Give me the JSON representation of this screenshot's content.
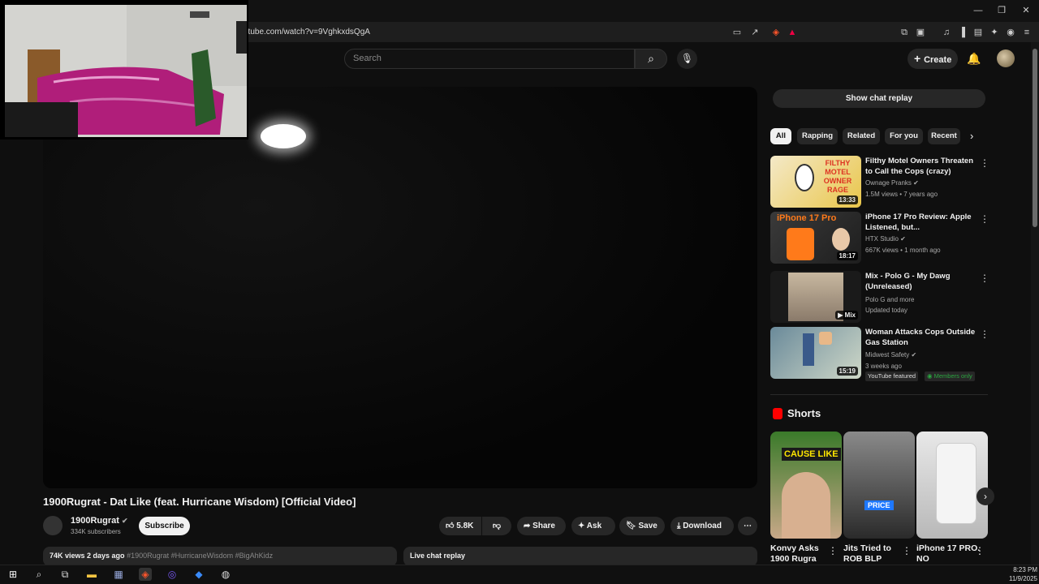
{
  "browser": {
    "url": "utube.com/watch?v=9VghkxdsQgA",
    "window_controls": {
      "minimize": "—",
      "restore": "❐",
      "close": "✕"
    }
  },
  "masthead": {
    "search_placeholder": "Search",
    "create_label": "Create"
  },
  "video": {
    "title": "1900Rugrat - Dat Like (feat. Hurricane Wisdom) [Official Video]",
    "channel": "1900Rugrat",
    "subscribers": "334K subscribers",
    "subscribe_label": "Subscribe",
    "likes": "5.8K",
    "share_label": "Share",
    "ask_label": "Ask",
    "save_label": "Save",
    "download_label": "Download",
    "description": "74K views  2 days ago",
    "hashtags": "#1900Rugrat #HurricaneWisdom #BigAhKidz",
    "live_chat": "Live chat replay"
  },
  "sidebar": {
    "show_chat": "Show chat replay",
    "chips": [
      "All",
      "Rapping",
      "Related",
      "For you",
      "Recent"
    ],
    "recommendations": [
      {
        "title": "Filthy Motel Owners Threaten to Call the Cops (crazy)",
        "channel": "Ownage Pranks",
        "meta": "1.5M views • 7 years ago",
        "duration": "13:33"
      },
      {
        "title": "iPhone 17 Pro Review: Apple Listened, but...",
        "channel": "HTX Studio",
        "meta": "667K views • 1 month ago",
        "duration": "18:17"
      },
      {
        "title": "Mix - Polo G - My Dawg (Unreleased)",
        "channel": "Polo G and more",
        "meta": "Updated today",
        "duration": "Mix"
      },
      {
        "title": "Woman Attacks Cops Outside Gas Station",
        "channel": "Midwest Safety",
        "meta": "3 weeks ago",
        "duration": "15:19",
        "badges": [
          "YouTube featured",
          "Members only"
        ]
      }
    ],
    "shorts_heading": "Shorts",
    "shorts": [
      {
        "title": "Konvy Asks 1900 Rugra",
        "overlay": "CAUSE LIKE"
      },
      {
        "title": "Jits Tried to ROB BLP",
        "overlay": "PRICE"
      },
      {
        "title": "iPhone 17 PRO. NO",
        "overlay": ""
      }
    ],
    "thumb_texts": {
      "motel": "FILTHY MOTEL OWNER RAGE",
      "iphone": "iPhone 17 Pro"
    }
  },
  "taskbar": {
    "time": "8:23 PM",
    "date": "11/9/2025"
  },
  "colors": {
    "accent": "#ff0000",
    "members": "#2ba640"
  }
}
